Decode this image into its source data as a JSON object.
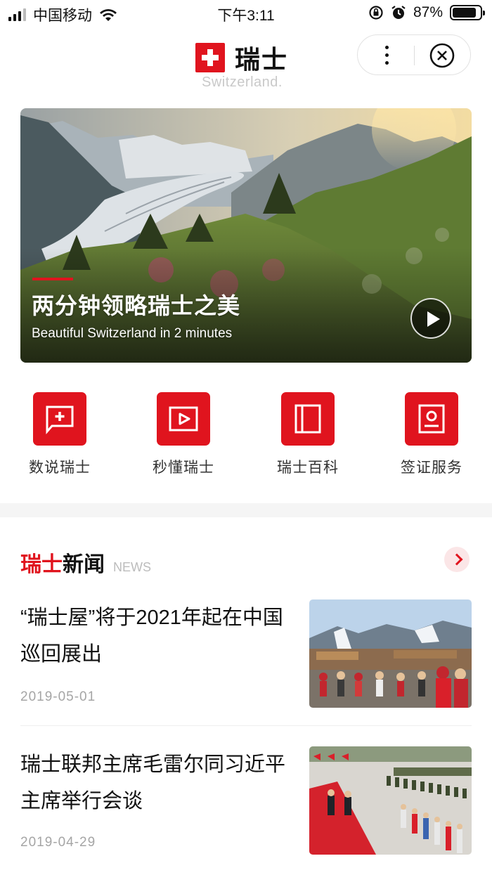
{
  "status_bar": {
    "carrier": "中国移动",
    "time": "下午3:11",
    "battery_percent": "87%",
    "battery_level": 0.87,
    "icons": [
      "signal-icon",
      "wifi-icon",
      "orientation-lock-icon",
      "alarm-icon",
      "battery-icon"
    ]
  },
  "header": {
    "title": "瑞士",
    "subtitle": "Switzerland.",
    "icons": [
      "swiss-flag-icon",
      "more-icon",
      "close-icon"
    ]
  },
  "hero": {
    "title": "两分钟领略瑞士之美",
    "subtitle": "Beautiful Switzerland in 2 minutes",
    "icon": "play-icon"
  },
  "quick_entries": [
    {
      "label": "数说瑞士",
      "icon": "flag-card-icon"
    },
    {
      "label": "秒懂瑞士",
      "icon": "video-play-icon"
    },
    {
      "label": "瑞士百科",
      "icon": "book-icon"
    },
    {
      "label": "签证服务",
      "icon": "id-photo-icon"
    }
  ],
  "news": {
    "title_red": "瑞士",
    "title_dark": "新闻",
    "title_en": "NEWS",
    "items": [
      {
        "headline": "“瑞士屋”将于2021年起在中国巡回展出",
        "date": "2019-05-01"
      },
      {
        "headline": "瑞士联邦主席毛雷尔同习近平主席举行会谈",
        "date": "2019-04-29"
      }
    ]
  },
  "colors": {
    "accent": "#e0141e",
    "text": "#111111",
    "muted": "#a5a5a5",
    "divider": "#f5f5f5"
  }
}
